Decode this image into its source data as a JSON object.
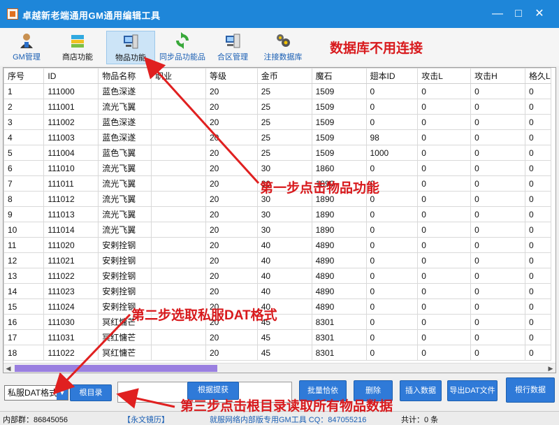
{
  "window": {
    "title": "卓越新老端通用GM通用编辑工具"
  },
  "toolbar": {
    "items": [
      {
        "label": "GM管理",
        "icon": "person-icon"
      },
      {
        "label": "商店功能",
        "icon": "shop-icon"
      },
      {
        "label": "物品功能",
        "icon": "item-computer-icon"
      },
      {
        "label": "同步品功能品",
        "icon": "refresh-icon"
      },
      {
        "label": "合区管理",
        "icon": "server-icon"
      },
      {
        "label": "注接数据库",
        "icon": "database-icon"
      }
    ]
  },
  "annotations": {
    "no_db": "数据库不用连接",
    "step1": "第一步点击物品功能",
    "step2": "第二步选取私服DAT格式",
    "step3": "第三步点击根目录读取所有物品数据"
  },
  "table": {
    "columns": [
      "序号",
      "ID",
      "物品名称",
      "职业",
      "等级",
      "金币",
      "魔石",
      "翅本ID",
      "攻击L",
      "攻击H",
      "格久L"
    ],
    "rows": [
      [
        "1",
        "111000",
        "蓝色深遂",
        "",
        "20",
        "25",
        "1509",
        "0",
        "0",
        "0",
        "0"
      ],
      [
        "2",
        "111001",
        "流光飞翼",
        "",
        "20",
        "25",
        "1509",
        "0",
        "0",
        "0",
        "0"
      ],
      [
        "3",
        "111002",
        "蓝色深遂",
        "",
        "20",
        "25",
        "1509",
        "0",
        "0",
        "0",
        "0"
      ],
      [
        "4",
        "111003",
        "蓝色深遂",
        "",
        "20",
        "25",
        "1509",
        "98",
        "0",
        "0",
        "0"
      ],
      [
        "5",
        "111004",
        "蓝色飞翼",
        "",
        "20",
        "25",
        "1509",
        "1000",
        "0",
        "0",
        "0"
      ],
      [
        "6",
        "111010",
        "流光飞翼",
        "",
        "20",
        "30",
        "1860",
        "0",
        "0",
        "0",
        "0"
      ],
      [
        "7",
        "111011",
        "流光飞翼",
        "",
        "20",
        "30",
        "1890",
        "0",
        "0",
        "0",
        "0"
      ],
      [
        "8",
        "111012",
        "流光飞翼",
        "",
        "20",
        "30",
        "1890",
        "0",
        "0",
        "0",
        "0"
      ],
      [
        "9",
        "111013",
        "流光飞翼",
        "",
        "20",
        "30",
        "1890",
        "0",
        "0",
        "0",
        "0"
      ],
      [
        "10",
        "111014",
        "流光飞翼",
        "",
        "20",
        "30",
        "1890",
        "0",
        "0",
        "0",
        "0"
      ],
      [
        "11",
        "111020",
        "安剌拴钢",
        "",
        "20",
        "40",
        "4890",
        "0",
        "0",
        "0",
        "0"
      ],
      [
        "12",
        "111021",
        "安剌拴钢",
        "",
        "20",
        "40",
        "4890",
        "0",
        "0",
        "0",
        "0"
      ],
      [
        "13",
        "111022",
        "安剌拴钢",
        "",
        "20",
        "40",
        "4890",
        "0",
        "0",
        "0",
        "0"
      ],
      [
        "14",
        "111023",
        "安剌拴钢",
        "",
        "20",
        "40",
        "4890",
        "0",
        "0",
        "0",
        "0"
      ],
      [
        "15",
        "111024",
        "安剌拴钢",
        "",
        "20",
        "40",
        "4890",
        "0",
        "0",
        "0",
        "0"
      ],
      [
        "16",
        "111030",
        "冥红慵芒",
        "",
        "20",
        "45",
        "8301",
        "0",
        "0",
        "0",
        "0"
      ],
      [
        "17",
        "111031",
        "冥红慵芒",
        "",
        "20",
        "45",
        "8301",
        "0",
        "0",
        "0",
        "0"
      ],
      [
        "18",
        "111022",
        "冥红慵芒",
        "",
        "20",
        "45",
        "8301",
        "0",
        "0",
        "0",
        "0"
      ]
    ]
  },
  "bottom": {
    "format_select": "私服DAT格式",
    "root_button": "根目录",
    "path_value": "",
    "buttons": {
      "edit": "根据提获",
      "batch": "批量恰依",
      "delete": "删除",
      "insert": "插入数据",
      "export": "导出DAT文件",
      "save": "根行数据"
    }
  },
  "status": {
    "left": "内部群：86845056",
    "mid1": "【永文镜历】",
    "mid2": "就服网络内部版专用GM工具 CQ：847055216",
    "count": "共计：0 条"
  },
  "colors": {
    "titlebar": "#1e86d9",
    "button": "#2f7ad8",
    "annotation": "#d8191c"
  }
}
